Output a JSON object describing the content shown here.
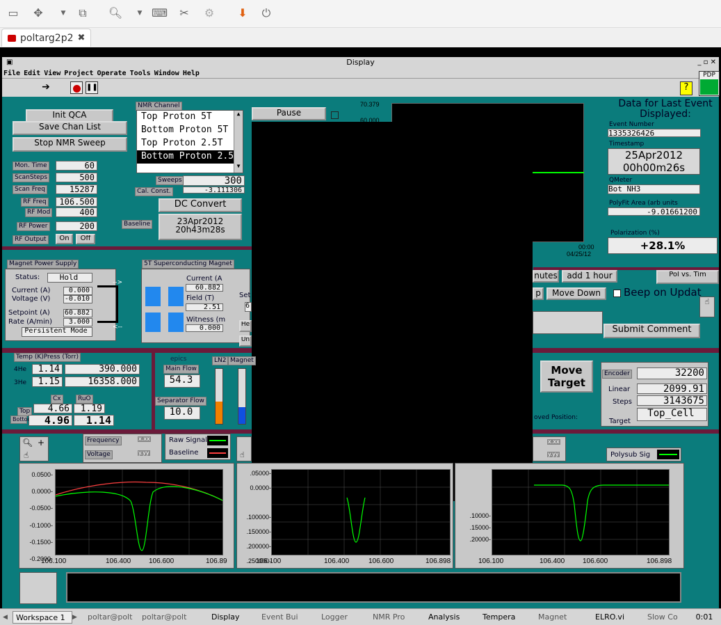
{
  "app": {
    "tab_title": "poltarg2p2",
    "window_title": "Display"
  },
  "menu": [
    "File",
    "Edit",
    "View",
    "Project",
    "Operate",
    "Tools",
    "Window",
    "Help"
  ],
  "badges": {
    "pdp": "PDP"
  },
  "nmr": {
    "init_qca": "Init QCA",
    "save_chan_list": "Save Chan List",
    "stop_sweep": "Stop NMR Sweep",
    "channel_label": "NMR Channel",
    "channels": [
      "Top Proton 5T",
      "Bottom Proton 5T",
      "Top Proton 2.5T",
      "Bottom Proton 2.5T"
    ],
    "selected_channel": 3,
    "mon_time_label": "Mon. Time",
    "mon_time": "60",
    "scan_steps_label": "ScanSteps",
    "scan_steps": "500",
    "scan_freq_label": "Scan Freq",
    "scan_freq": "15287",
    "rf_freq_label": "RF Freq",
    "rf_freq": "106.500",
    "rf_mod_label": "RF Mod",
    "rf_mod": "400",
    "rf_power_label": "RF Power",
    "rf_power": "200",
    "rf_output_label": "RF Output",
    "on": "On",
    "off": "Off",
    "sweeps_label": "Sweeps",
    "sweeps": "300",
    "cal_const_label": "Cal. Const.",
    "cal_const": "-3.111306",
    "dc_convert": "DC Convert",
    "baseline_label": "Baseline",
    "baseline_date": "23Apr2012",
    "baseline_time": "20h43m28s"
  },
  "center": {
    "pause": "Pause",
    "y_top": "70.379",
    "y_second": "60.000",
    "x_time": "00:00",
    "x_date": "04/25/12",
    "minutes_btn": "nutes",
    "add_hour": "add 1 hour",
    "move_down": "Move Down",
    "p_btn": "p",
    "submit_comment": "Submit Comment",
    "beep": "Beep on Updat",
    "pol_vs_time": "Pol vs. Tim"
  },
  "event": {
    "title": "Data for Last Event Displayed:",
    "event_number_label": "Event Number",
    "event_number": "1335326426",
    "timestamp_label": "Timestamp",
    "ts_date": "25Apr2012",
    "ts_time": "00h00m26s",
    "qmeter_label": "QMeter",
    "qmeter": "Bot NH3",
    "polyfit_label": "PolyFit Area (arb units",
    "polyfit": "-9.01661200",
    "polarization_label": "Polarization (%)",
    "polarization": "+28.1%"
  },
  "magnet_ps": {
    "title": "Magnet Power Supply",
    "status_label": "Status:",
    "status": "Hold",
    "current_label": "Current (A)",
    "current": "0.000",
    "voltage_label": "Voltage (V)",
    "voltage": "-0.010",
    "setpoint_label": "Setpoint (A)",
    "setpoint": "60.882",
    "rate_label": "Rate (A/min)",
    "rate": "3.000",
    "mode": "Persistent Mode"
  },
  "sc_magnet": {
    "title": "5T Superconducting Magnet",
    "current_label": "Current (A",
    "current": "60.882",
    "field_label": "Field (T)",
    "field": "2.51",
    "witness_label": "Witness (m",
    "witness": "0.000",
    "set_label": "Set",
    "set_val": "6",
    "he_btn": "He",
    "un_btn": "Un"
  },
  "temps": {
    "title": "Temp (K)Press (Torr)",
    "he4_label": "4He",
    "he4_temp": "1.14",
    "he4_press": "390.000",
    "he3_label": "3He",
    "he3_temp": "1.15",
    "he3_press": "16358.000",
    "cx_label": "Cx",
    "ruo_label": "RuO",
    "top_label": "Top",
    "top_cx": "4.66",
    "top_ruo": "1.19",
    "bottom_label": "Bottom",
    "bottom_cx": "4.96",
    "bottom_ruo": "1.14"
  },
  "flows": {
    "epics": "epics",
    "main_flow_label": "Main Flow",
    "main_flow": "54.3",
    "sep_flow_label": "Separator Flow",
    "sep_flow": "10.0",
    "ln2_label": "LN2",
    "magnet_label": "Magnet",
    "ln2_level": 0.4,
    "magnet_level": 0.3
  },
  "target": {
    "move_target": "Move Target",
    "encoder_label": "Encoder",
    "encoder": "32200",
    "linear_label": "Linear",
    "linear": "2099.91",
    "steps_label": "Steps",
    "steps": "3143675",
    "target_label": "Target",
    "target": "Top_Cell",
    "moved_label": "oved Position:"
  },
  "plots": {
    "frequency_label": "Frequency",
    "voltage_label": "Voltage",
    "xfmt": "x.xx",
    "yfmt": "y.yy",
    "raw_signal_label": "Raw Signal",
    "baseline_label": "Baseline",
    "polysub_label": "Polysub Sig",
    "left_y": [
      "0.0500-",
      "0.0000-",
      "-0.0500-",
      "-0.1000-",
      "-0.1500-",
      "-0.2000-"
    ],
    "left_x": [
      "106.100",
      "106.400",
      "106.600",
      "106.89"
    ],
    "mid_y": [
      ".05000-",
      "0.0000-",
      ".100000-",
      ".150000-",
      ".200000-",
      ".250000-"
    ],
    "mid_x": [
      "106.100",
      "106.400",
      "106.600",
      "106.898"
    ],
    "right_y": [
      ".10000-",
      ".15000-",
      ".20000-"
    ],
    "right_x": [
      "106.100",
      "106.400",
      "106.600",
      "106.898"
    ]
  },
  "taskbar": [
    "Workspace 1",
    "poltar@polt",
    "poltar@polt",
    "Display",
    "Event Bui",
    "Logger",
    "NMR Pro",
    "Analysis",
    "Tempera",
    "Magnet",
    "ELRO.vi",
    "Slow Co",
    "0:01"
  ],
  "colors": {
    "panel": "#0b7c7c",
    "separator": "#6b1a3a",
    "signal": "#00ff00",
    "baseline": "#ff4040"
  }
}
